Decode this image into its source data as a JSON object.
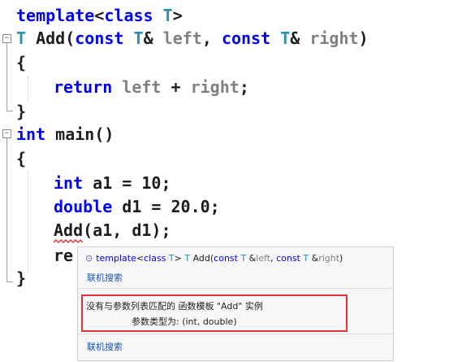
{
  "code": {
    "l1_kw1": "template",
    "l1_rest": "<",
    "l1_kw2": "class",
    "l1_T": "T",
    "l1_close": ">",
    "l2_T": "T",
    "l2_name": " Add(",
    "l2_const1": "const",
    "l2_T2": "T",
    "l2_amp1": "& ",
    "l2_left": "left",
    "l2_comma": ", ",
    "l2_const2": "const",
    "l2_T3": "T",
    "l2_amp2": "& ",
    "l2_right": "right",
    "l2_paren": ")",
    "l3": "{",
    "l4_kw": "return",
    "l4_left": "left",
    "l4_plus": " + ",
    "l4_right": "right",
    "l4_semi": ";",
    "l5": "}",
    "l6_kw": "int",
    "l6_rest": " main()",
    "l7": "{",
    "l8_kw": "int",
    "l8_rest": " a1 = ",
    "l8_num": "10",
    "l8_semi": ";",
    "l9_kw": "double",
    "l9_rest": " d1 = ",
    "l9_num": "20.0",
    "l9_semi": ";",
    "l10": "Add(a1, d1);",
    "l11": "re",
    "l12": "}"
  },
  "tooltip": {
    "icon": "⊙",
    "sig_kw1": "template",
    "sig_lt": "<",
    "sig_kw2": "class",
    "sig_T1": " T",
    "sig_gt": "> ",
    "sig_T2": "T",
    "sig_name": " Add(",
    "sig_const1": "const",
    "sig_T3": " T",
    "sig_amp1": " &",
    "sig_left": "left",
    "sig_comma": ", ",
    "sig_const2": "const",
    "sig_T4": " T",
    "sig_amp2": " &",
    "sig_right": "right",
    "sig_paren": ")",
    "search_label_1": "联机搜索",
    "error_line_1": "没有与参数列表匹配的 函数模板 \"Add\" 实例",
    "error_line_2": "参数类型为:  (int, double)",
    "search_label_2": "联机搜索"
  },
  "colors": {
    "keyword": "#0000ff",
    "type": "#2b91af",
    "parameter": "#808080",
    "error_border": "#e0343a",
    "squiggle": "#e0343a",
    "link": "#1a55a8"
  }
}
